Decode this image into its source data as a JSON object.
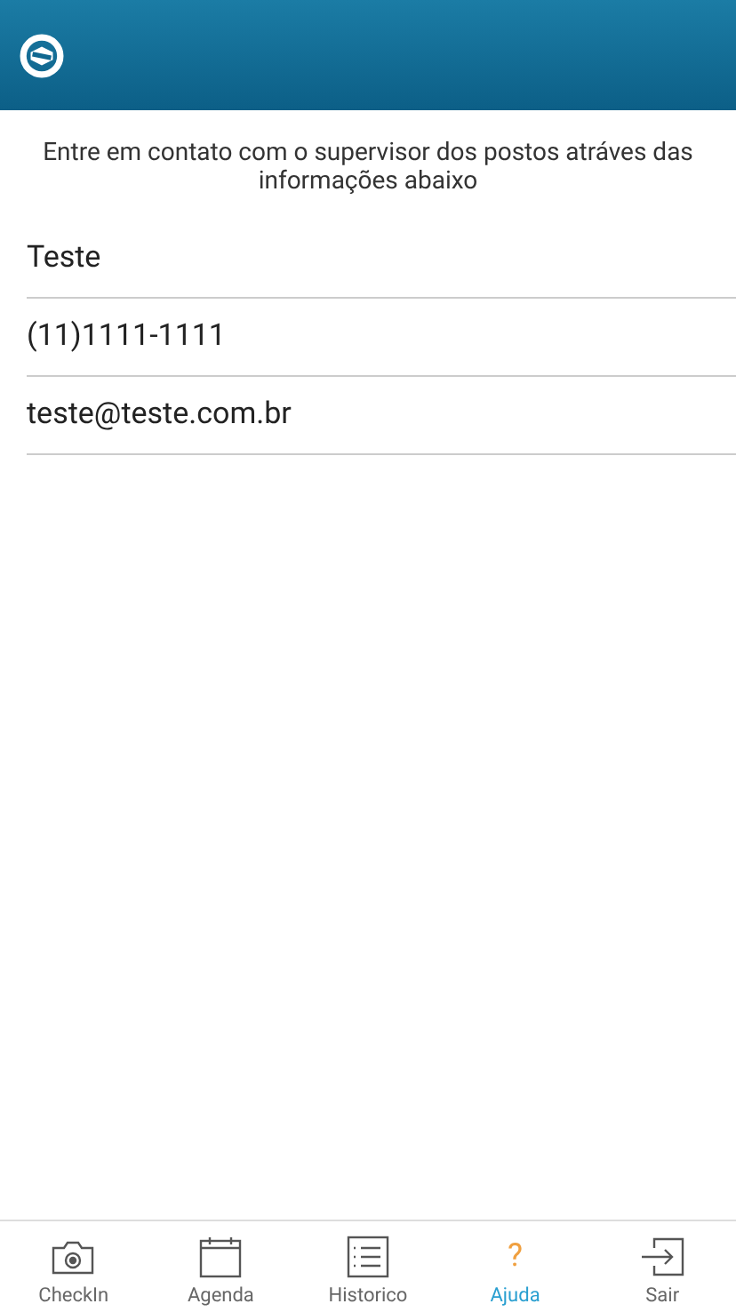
{
  "intro": "Entre em contato com o supervisor dos postos atráves das informações abaixo",
  "contacts": [
    "Teste",
    "(11)1111-1111",
    "teste@teste.com.br"
  ],
  "nav": [
    {
      "label": "CheckIn",
      "kind": "camera",
      "selected": false
    },
    {
      "label": "Agenda",
      "kind": "calendar",
      "selected": false
    },
    {
      "label": "Historico",
      "kind": "list",
      "selected": false
    },
    {
      "label": "Ajuda",
      "kind": "help",
      "glyph": "?",
      "selected": true
    },
    {
      "label": "Sair",
      "kind": "exit",
      "selected": false
    }
  ]
}
